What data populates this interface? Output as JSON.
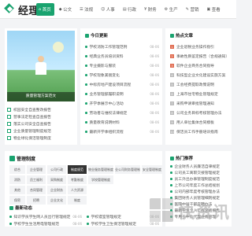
{
  "header": {
    "logo_text": "经理人",
    "nav": [
      {
        "icon": "⌂",
        "label": "首页"
      },
      {
        "icon": "◆",
        "label": "公文"
      },
      {
        "icon": "☰",
        "label": "法规"
      },
      {
        "icon": "☺",
        "label": "人事"
      },
      {
        "icon": "▤",
        "label": "行政"
      },
      {
        "icon": "¥",
        "label": "财务"
      },
      {
        "icon": "⚙",
        "label": "生产"
      },
      {
        "icon": "✎",
        "label": "营销"
      },
      {
        "icon": "▣",
        "label": "查看"
      }
    ]
  },
  "featured": {
    "caption": "质量管理方案范文",
    "list": [
      "校园安全自查整改报告",
      "营事法定检查自查报告",
      "落实公司安全自查报告",
      "企业质量管理制度规范",
      "物业绿化保洁管理制度"
    ]
  },
  "today": {
    "title": "今日更新",
    "items": [
      {
        "text": "学校消防工作管理范例",
        "date": "08-06"
      },
      {
        "text": "经典业务员培训资料",
        "date": "08-06"
      },
      {
        "text": "专业摄影与服装",
        "date": "08-06"
      },
      {
        "text": "学校现象美丽变化",
        "date": "08-06"
      },
      {
        "text": "中标房地产建设项目流程",
        "date": "08-06"
      },
      {
        "text": "业务管理部履职说明",
        "date": "08-06"
      },
      {
        "text": "开学季展示中心活动",
        "date": "08-06"
      },
      {
        "text": "劳动者与维权法律规定",
        "date": "08-06"
      },
      {
        "text": "质量教育说明材料",
        "date": "08-06"
      },
      {
        "text": "最新开学季组织流程",
        "date": "08-06"
      }
    ]
  },
  "hot": {
    "title": "热点文章",
    "items": [
      "企业退税业务操作指引",
      "事故性质鉴定报告（合规通知）",
      "软件企业商务合同指导",
      "科技型企业文化建设实施方案",
      "工会经费提取政策说明",
      "上海市住宅物业管理规定",
      "采购申请审批管理通知",
      "公司业务目标考核管理办法",
      "用人单位集体合同模板",
      "保洁员工作手册培训指南"
    ]
  },
  "system": {
    "title": "管理制度",
    "tabs": [
      [
        "综合",
        "企业管理",
        "公司行政",
        "制度规范",
        "物业服务管理制度",
        "物业公司财务管理制度",
        "安全管理制度"
      ],
      [
        "消防",
        "员工福利",
        "采购制度",
        "考勤制度",
        "学校管理制度",
        "",
        ""
      ],
      [
        "其他",
        "合同管理",
        "企业财务",
        "人力资源",
        "",
        "",
        ""
      ],
      [
        "保密",
        "招聘",
        "企业文化",
        "制度",
        "",
        "",
        ""
      ]
    ]
  },
  "news": {
    "title": "最新动态",
    "items": [
      {
        "text": "知识学员学生网人员出行管理规定",
        "date": "08-06"
      },
      {
        "text": "学校学生生活用电管理规范",
        "date": "08-06"
      }
    ],
    "items2": [
      {
        "text": "学校寝室管理规定",
        "date": "08-06"
      },
      {
        "text": "学校学生卫生保洁管理规定",
        "date": "08-06"
      }
    ]
  },
  "recommend": {
    "title": "热门推荐",
    "items": [
      "企业财务人员廉洁自律规定",
      "公司员工离职交接管理规定",
      "员工外出办事管理制度规范",
      "上市公司年度工作总结规划",
      "公司内部年度考核管理办法",
      "集团财务人员管理细则规定",
      "医院中层干部竞聘办法",
      "最新学生个人工作总结报告",
      "专用于中介代理业务管理"
    ]
  },
  "watermark": {
    "text": "快资讯"
  }
}
